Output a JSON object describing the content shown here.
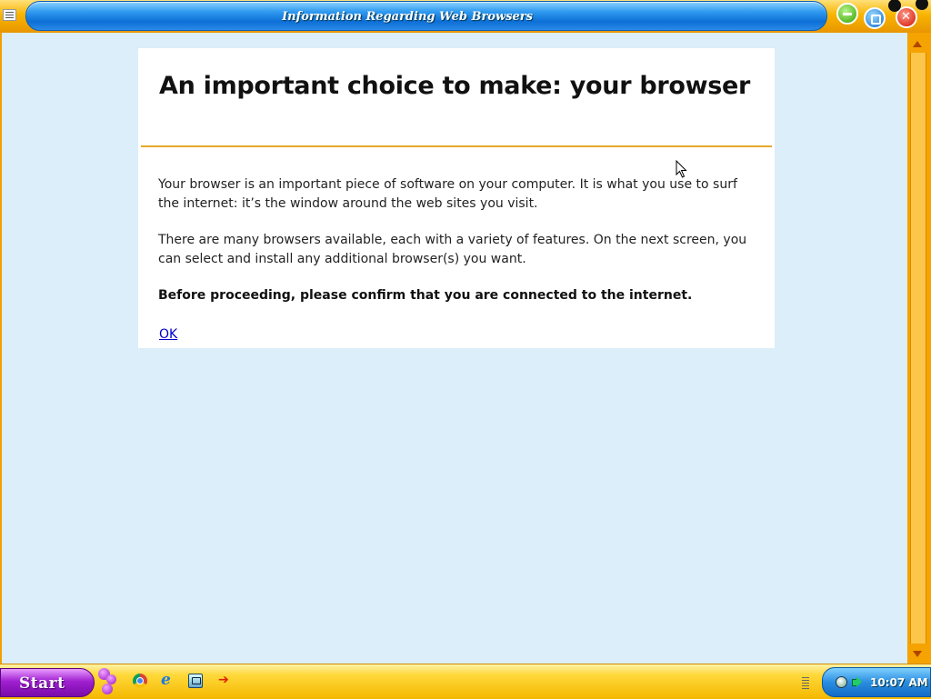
{
  "window": {
    "title": "Information Regarding Web Browsers"
  },
  "content": {
    "heading": "An important choice to make: your browser",
    "paragraph1": "Your browser is an important piece of software on your computer. It is what you use to surf the internet: it’s the window around the web sites you visit.",
    "paragraph2": "There are many browsers available, each with a variety of features. On the next screen, you can select and install any additional browser(s) you want.",
    "paragraph3": "Before proceeding, please confirm that you are connected to the internet.",
    "ok_link": "OK"
  },
  "taskbar": {
    "start_label": "Start",
    "quick_launch": [
      "chrome-icon",
      "internet-explorer-icon",
      "show-desktop-icon",
      "arrow-icon"
    ],
    "clock": "10:07 AM"
  },
  "colors": {
    "client_background": "#dbeef9",
    "rule": "#e8a82a",
    "link": "#0000cc",
    "frame": "#f5a300",
    "title_pill": "#0d6fd6",
    "start_button": "#a020d0"
  }
}
